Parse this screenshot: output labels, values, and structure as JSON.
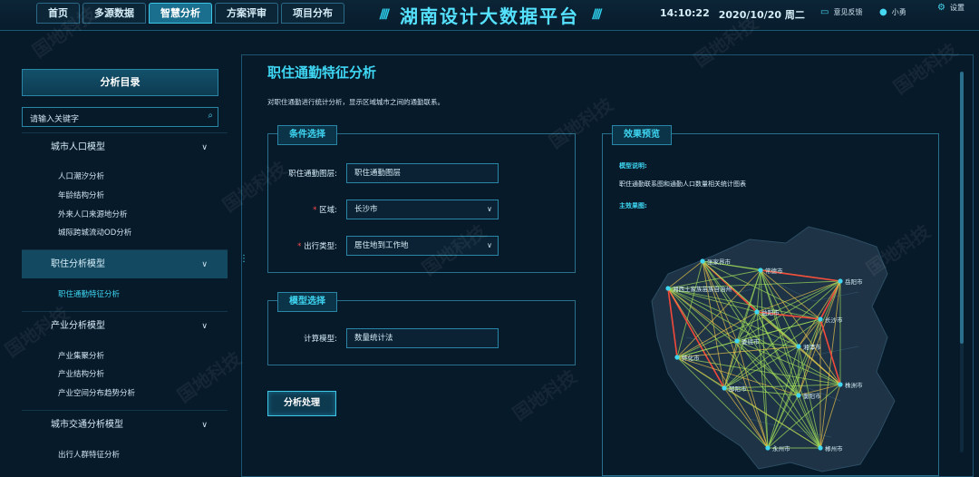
{
  "nav": {
    "tabs": [
      {
        "label": "首页"
      },
      {
        "label": "多源数据"
      },
      {
        "label": "智慧分析"
      },
      {
        "label": "方案评审"
      },
      {
        "label": "项目分布"
      }
    ]
  },
  "header": {
    "title": "湖南设计大数据平台",
    "time": "14:10:22",
    "date": "2020/10/20 周二",
    "feedback": "意见反馈",
    "user": "小勇",
    "settings": "设置"
  },
  "sidebar": {
    "title": "分析目录",
    "search_placeholder": "请输入关键字",
    "groups": [
      {
        "label": "城市人口模型",
        "items": [
          "人口潮汐分析",
          "年龄结构分析",
          "外来人口来源地分析",
          "城际跨城流动OD分析"
        ]
      },
      {
        "label": "职住分析模型",
        "items": [
          "职住通勤特征分析"
        ]
      },
      {
        "label": "产业分析模型",
        "items": [
          "产业集聚分析",
          "产业结构分析",
          "产业空间分布趋势分析"
        ]
      },
      {
        "label": "城市交通分析模型",
        "items": [
          "出行人群特征分析"
        ]
      }
    ]
  },
  "main": {
    "title": "职住通勤特征分析",
    "description": "对职住通勤进行统计分析，显示区域城市之间的通勤联系。",
    "condition": {
      "title": "条件选择",
      "layer_label": "职住通勤图层:",
      "layer_value": "职住通勤图层",
      "region_label": "区域:",
      "region_value": "长沙市",
      "trip_label": "出行类型:",
      "trip_value": "居住地到工作地"
    },
    "model": {
      "title": "模型选择",
      "calc_label": "计算模型:",
      "calc_value": "数量统计法"
    },
    "analyze_button": "分析处理",
    "preview": {
      "title": "效果预览",
      "model_desc_key": "模型说明:",
      "model_desc_value": "职住通勤联系图和通勤人口数量相关统计图表",
      "effect_key": "主效果图:",
      "cities": [
        {
          "name": "张家界市"
        },
        {
          "name": "常德市"
        },
        {
          "name": "岳阳市"
        },
        {
          "name": "湘西土家族苗族自治州"
        },
        {
          "name": "益阳市"
        },
        {
          "name": "长沙市"
        },
        {
          "name": "娄底市"
        },
        {
          "name": "湘潭市"
        },
        {
          "name": "怀化市"
        },
        {
          "name": "邵阳市"
        },
        {
          "name": "衡阳市"
        },
        {
          "name": "株洲市"
        },
        {
          "name": "永州市"
        },
        {
          "name": "郴州市"
        }
      ]
    }
  },
  "watermark": "国地科技",
  "colors": {
    "accent": "#3ed6f2",
    "background": "#071a2a",
    "strong_link": "#ff4a3a",
    "medium_link": "#f2c94a",
    "weak_link": "#a6e35a"
  }
}
